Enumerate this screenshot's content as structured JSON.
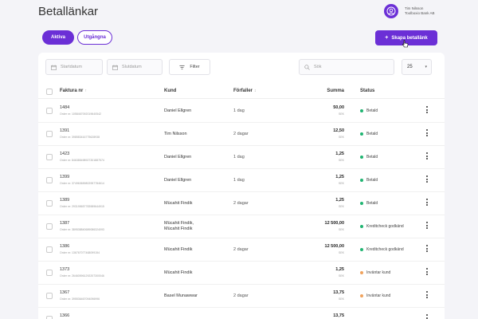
{
  "page_title": "Betallänkar",
  "user": {
    "name": "Tim Nilsson",
    "company": "Toolboxio Bank AB"
  },
  "tabs": {
    "active": "Aktiva",
    "inactive": "Utgångna"
  },
  "create_button": "Skapa betallänk",
  "filters": {
    "start_date": "Startdatum",
    "end_date": "Slutdatum",
    "filter_label": "Filter",
    "search_placeholder": "Sök",
    "per_page": "25"
  },
  "columns": {
    "invoice": "Faktura nr",
    "customer": "Kund",
    "due": "Förfaller",
    "sum": "Summa",
    "status": "Status"
  },
  "rows": [
    {
      "invoice": "1484",
      "order": "Order nr: 1058467092019640542",
      "customer": "Daniel Ellgren",
      "due": "1 dag",
      "amount": "50,00",
      "currency": "SEK",
      "status": "Betald"
    },
    {
      "invoice": "1391",
      "order": "Order nr: 398583416775628938",
      "customer": "Tim Nilsson",
      "due": "2 dagar",
      "amount": "12,50",
      "currency": "SEK",
      "status": "Betald"
    },
    {
      "invoice": "1423",
      "order": "Order nr: 846385498927301887574",
      "customer": "Daniel Ellgren",
      "due": "1 dag",
      "amount": "1,25",
      "currency": "SEK",
      "status": "Betald"
    },
    {
      "invoice": "1399",
      "order": "Order nr: 374963659802957784614",
      "customer": "Daniel Ellgren",
      "due": "1 dag",
      "amount": "1,25",
      "currency": "SEK",
      "status": "Betald"
    },
    {
      "invoice": "1389",
      "order": "Order nr: 293195657783989644915",
      "customer": "Mücahit Findik",
      "due": "2 dagar",
      "amount": "1,25",
      "currency": "SEK",
      "status": "Betald"
    },
    {
      "invoice": "1387",
      "order": "Order nr: 389538840689086324093",
      "customer": "Mücahit Findik,",
      "customer2": "Mücahit Findik",
      "due": "",
      "amount": "12 500,00",
      "currency": "SEK",
      "status": "Kreditcheck godkänd"
    },
    {
      "invoice": "1386",
      "order": "Order nr: 136767077468099154",
      "customer": "Mücahit Findik",
      "due": "2 dagar",
      "amount": "12 500,00",
      "currency": "SEK",
      "status": "Kreditcheck godkänd"
    },
    {
      "invoice": "1373",
      "order": "Order nr: 264605961292207300046",
      "customer": "Mücahit Findik",
      "due": "",
      "amount": "1,25",
      "currency": "SEK",
      "status": "Inväntar kund"
    },
    {
      "invoice": "1367",
      "order": "Order nr: 395536467094096996",
      "customer": "Basel Munawwar",
      "due": "2 dagar",
      "amount": "13,75",
      "currency": "SEK",
      "status": "Inväntar kund"
    },
    {
      "invoice": "1366",
      "order": "",
      "customer": "",
      "due": "",
      "amount": "13,75",
      "currency": "",
      "status": ""
    }
  ],
  "colors": {
    "accent": "#6b2fd6",
    "paid": "#22b573",
    "credit": "#22b573",
    "waiting": "#f0a35e"
  }
}
